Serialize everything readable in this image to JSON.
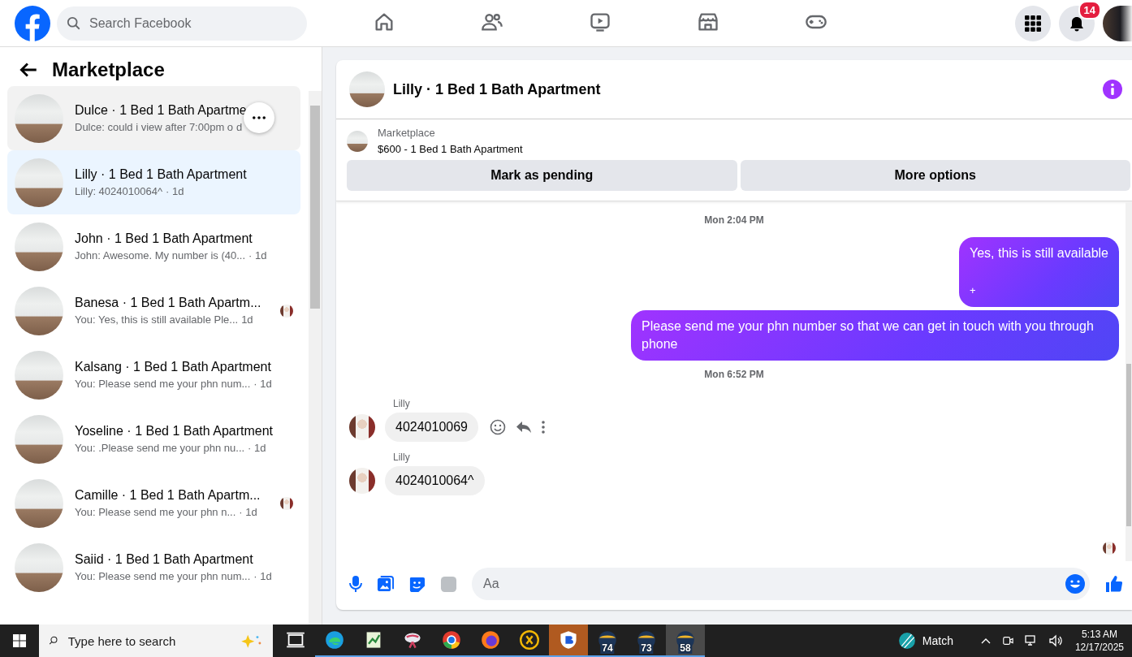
{
  "topbar": {
    "search": {
      "placeholder": "Search Facebook"
    },
    "nav": [
      {
        "kind": "home",
        "selected": false
      },
      {
        "kind": "friends",
        "selected": false
      },
      {
        "kind": "video",
        "selected": false
      },
      {
        "kind": "marketplace",
        "selected": false
      },
      {
        "kind": "gaming",
        "selected": false
      }
    ],
    "notifications_badge": "14"
  },
  "sidebar": {
    "title": "Marketplace",
    "conversations": [
      {
        "title": "Dulce · 1 Bed 1 Bath Apartme",
        "preview": "Dulce: could i view after 7:00pm o",
        "time": "d",
        "selected": false,
        "hovered": true,
        "seen_avatar": false
      },
      {
        "title": "Lilly · 1 Bed 1 Bath Apartment",
        "preview": "Lilly: 4024010064^",
        "time": "· 1d",
        "selected": true,
        "hovered": false,
        "seen_avatar": false
      },
      {
        "title": "John · 1 Bed 1 Bath Apartment",
        "preview": "John: Awesome. My number is (40...",
        "time": "· 1d",
        "selected": false,
        "hovered": false,
        "seen_avatar": false
      },
      {
        "title": "Banesa · 1 Bed 1 Bath Apartm...",
        "preview": "You: Yes, this is still available Ple...",
        "time": "1d",
        "selected": false,
        "hovered": false,
        "seen_avatar": true
      },
      {
        "title": "Kalsang · 1 Bed 1 Bath Apartment",
        "preview": "You: Please send me your phn num...",
        "time": "· 1d",
        "selected": false,
        "hovered": false,
        "seen_avatar": false
      },
      {
        "title": "Yoseline · 1 Bed 1 Bath Apartment",
        "preview": "You: .Please send me your phn nu...",
        "time": "· 1d",
        "selected": false,
        "hovered": false,
        "seen_avatar": false
      },
      {
        "title": "Camille · 1 Bed 1 Bath Apartm...",
        "preview": "You: Please send me your phn n...",
        "time": "· 1d",
        "selected": false,
        "hovered": false,
        "seen_avatar": true
      },
      {
        "title": "Saiid · 1 Bed 1 Bath Apartment",
        "preview": "You: Please send me your phn num...",
        "time": "· 1d",
        "selected": false,
        "hovered": false,
        "seen_avatar": false
      }
    ]
  },
  "chat": {
    "title": "Lilly · 1 Bed 1 Bath Apartment",
    "listing": {
      "source": "Marketplace",
      "name": "$600 - 1 Bed 1 Bath Apartment"
    },
    "actions": [
      "Mark as pending",
      "More options"
    ],
    "messages": [
      {
        "kind": "timestamp",
        "text": "Mon 2:04 PM"
      },
      {
        "kind": "outgoing",
        "text": "Yes, this is still available",
        "extra": "+"
      },
      {
        "kind": "outgoing",
        "text": "Please send me your phn number so that we can get in touch with you through phone"
      },
      {
        "kind": "timestamp",
        "text": "Mon 6:52 PM"
      },
      {
        "kind": "incoming",
        "sender": "Lilly",
        "text": "4024010069",
        "hovered": true
      },
      {
        "kind": "incoming",
        "sender": "Lilly",
        "text": "4024010064^",
        "hovered": false
      }
    ],
    "composer": {
      "placeholder": "Aa"
    }
  },
  "taskbar": {
    "search": {
      "placeholder": "Type here to search"
    },
    "apps": [
      {
        "kind": "taskview",
        "selected": false
      },
      {
        "kind": "edge",
        "selected": false
      },
      {
        "kind": "notes",
        "selected": false
      },
      {
        "kind": "snip",
        "selected": false
      },
      {
        "kind": "chrome",
        "selected": false
      },
      {
        "kind": "firefox",
        "selected": false
      },
      {
        "kind": "ix",
        "selected": false
      },
      {
        "kind": "shield",
        "selected": true
      },
      {
        "kind": "cricket",
        "label": "74",
        "selected": false
      },
      {
        "kind": "cricket",
        "label": "73",
        "selected": false
      },
      {
        "kind": "cricket",
        "label": "58",
        "selected": true
      }
    ],
    "weather": "Match",
    "time": "5:13 AM",
    "date": "12/17/2025"
  }
}
